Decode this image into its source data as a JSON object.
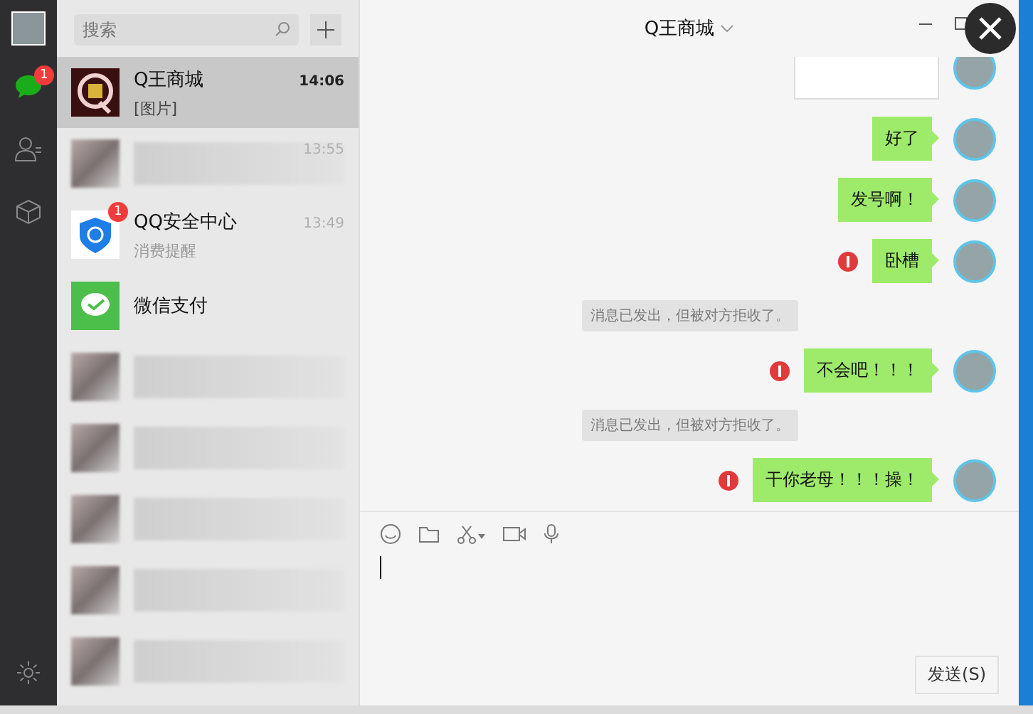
{
  "sidebar": {
    "items": [
      {
        "kind": "chat",
        "selected": true,
        "badge": "1"
      },
      {
        "kind": "contacts",
        "selected": false
      },
      {
        "kind": "favorites",
        "selected": false
      }
    ]
  },
  "search": {
    "placeholder": "搜索"
  },
  "chats": [
    {
      "kind": "logo",
      "name": "Q王商城",
      "time": "14:06",
      "preview": "[图片]",
      "selected": true
    },
    {
      "kind": "blurred",
      "time": "13:55",
      "selected": false
    },
    {
      "kind": "shield",
      "name": "QQ安全中心",
      "time": "13:49",
      "preview": "消费提醒",
      "badge": "1",
      "selected": false
    },
    {
      "kind": "pay",
      "name": "微信支付",
      "selected": false
    },
    {
      "kind": "blurred",
      "selected": false
    },
    {
      "kind": "blurred",
      "selected": false
    },
    {
      "kind": "blurred",
      "selected": false
    },
    {
      "kind": "blurred",
      "selected": false
    },
    {
      "kind": "blurred",
      "selected": false
    }
  ],
  "chat": {
    "title": "Q王商城",
    "messages": [
      {
        "kind": "image"
      },
      {
        "kind": "text",
        "text": "好了",
        "failed": false
      },
      {
        "kind": "text",
        "text": "发号啊！",
        "failed": false
      },
      {
        "kind": "text",
        "text": "卧槽",
        "failed": true
      },
      {
        "kind": "notice",
        "text": "消息已发出，但被对方拒收了。"
      },
      {
        "kind": "text",
        "text": "不会吧！！！",
        "failed": true
      },
      {
        "kind": "notice",
        "text": "消息已发出，但被对方拒收了。"
      },
      {
        "kind": "text",
        "text": "干你老母！！！操！",
        "failed": true
      }
    ],
    "send_button": "发送(S)"
  }
}
